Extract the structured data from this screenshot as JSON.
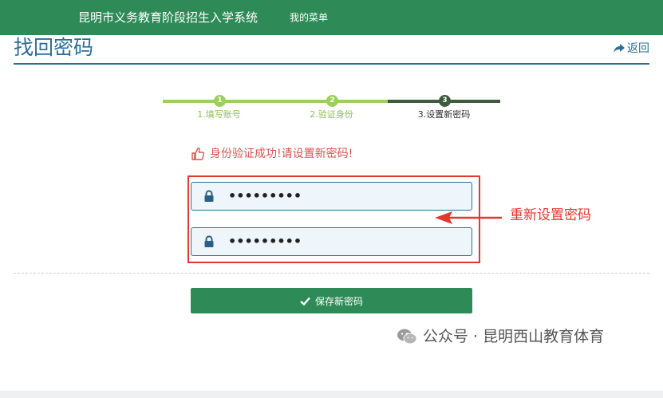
{
  "header": {
    "brand": "昆明市义务教育阶段招生入学系统",
    "menu": "我的菜单"
  },
  "page": {
    "title": "找回密码",
    "back_label": "返回"
  },
  "steps": [
    {
      "num": "1",
      "label": "1.填写账号",
      "state": "done"
    },
    {
      "num": "2",
      "label": "2.验证身份",
      "state": "done"
    },
    {
      "num": "3",
      "label": "3.设置新密码",
      "state": "active"
    }
  ],
  "message": {
    "text": "身份验证成功!请设置新密码!",
    "icon": "thumbs-up-icon"
  },
  "form": {
    "new_password": "•••••••••",
    "confirm_password": "•••••••••",
    "icon": "lock-icon"
  },
  "annotation": {
    "text": "重新设置密码",
    "color": "#e3382f"
  },
  "actions": {
    "save_label": "保存新密码",
    "icon": "check-icon"
  },
  "watermark": {
    "text": "公众号 · 昆明西山教育体育",
    "icon": "wechat-icon"
  },
  "colors": {
    "brand_green": "#2e8b57",
    "title_blue": "#2a6e99",
    "step_done": "#9ccf5f",
    "step_active": "#3d5a3c",
    "alert_red": "#d9534f"
  }
}
